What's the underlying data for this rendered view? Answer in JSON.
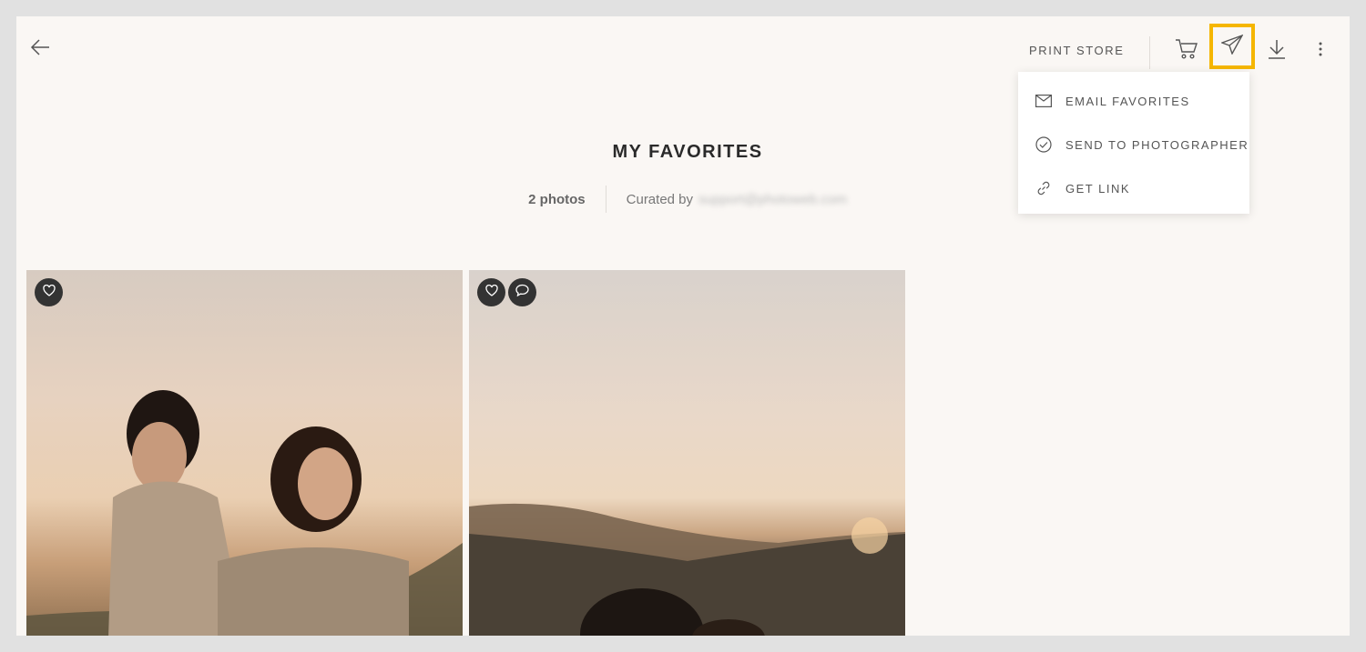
{
  "toolbar": {
    "back_icon": "arrow-left-icon",
    "print_store_label": "PRINT STORE",
    "cart_icon": "cart-icon",
    "share_icon": "paper-plane-icon",
    "download_icon": "download-icon",
    "more_icon": "more-vertical-icon",
    "highlight_color": "#f5b600"
  },
  "share_menu": {
    "items": [
      {
        "label": "EMAIL FAVORITES",
        "icon": "envelope-icon"
      },
      {
        "label": "SEND TO PHOTOGRAPHER",
        "icon": "check-circle-icon"
      },
      {
        "label": "GET LINK",
        "icon": "link-icon"
      }
    ]
  },
  "header": {
    "title": "MY FAVORITES",
    "photo_count": "2 photos",
    "curated_label": "Curated by",
    "curator": "support@photoweb.com"
  },
  "photos": [
    {
      "badges": [
        "heart-icon"
      ]
    },
    {
      "badges": [
        "heart-icon",
        "comment-icon"
      ]
    }
  ]
}
